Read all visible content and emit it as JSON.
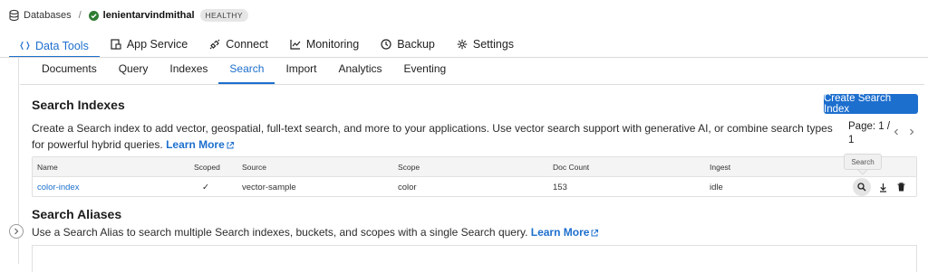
{
  "breadcrumb": {
    "root": "Databases",
    "separator": "/",
    "database_name": "lenientarvindmithal",
    "status": "HEALTHY",
    "status_color": "#2e7d32"
  },
  "primary_tabs": [
    {
      "label": "Data Tools",
      "icon": "code-braces-icon",
      "active": true
    },
    {
      "label": "App Service",
      "icon": "app-service-icon",
      "active": false
    },
    {
      "label": "Connect",
      "icon": "connect-icon",
      "active": false
    },
    {
      "label": "Monitoring",
      "icon": "chart-icon",
      "active": false
    },
    {
      "label": "Backup",
      "icon": "clock-icon",
      "active": false
    },
    {
      "label": "Settings",
      "icon": "gear-icon",
      "active": false
    }
  ],
  "secondary_tabs": [
    {
      "label": "Documents",
      "active": false
    },
    {
      "label": "Query",
      "active": false
    },
    {
      "label": "Indexes",
      "active": false
    },
    {
      "label": "Search",
      "active": true
    },
    {
      "label": "Import",
      "active": false
    },
    {
      "label": "Analytics",
      "active": false
    },
    {
      "label": "Eventing",
      "active": false
    }
  ],
  "search_indexes": {
    "title": "Search Indexes",
    "description": "Create a Search index to add vector, geospatial, full-text search, and more to your applications. Use vector search support with generative AI, or combine search types for powerful hybrid queries.",
    "learn_more": "Learn More",
    "create_button": "Create Search Index",
    "pager_label": "Page: 1 / 1",
    "table": {
      "headers": [
        "Name",
        "Scoped",
        "Source",
        "Scope",
        "Doc Count",
        "Ingest"
      ],
      "rows": [
        {
          "name": "color-index",
          "scoped": "✓",
          "source": "vector-sample",
          "scope": "color",
          "doc_count": "153",
          "ingest": "idle"
        }
      ]
    },
    "tooltip": "Search"
  },
  "search_aliases": {
    "title": "Search Aliases",
    "description": "Use a Search Alias to search multiple Search indexes, buckets, and scopes with a single Search query.",
    "learn_more": "Learn More"
  },
  "colors": {
    "accent": "#1d6fce",
    "healthy": "#2e7d32"
  }
}
